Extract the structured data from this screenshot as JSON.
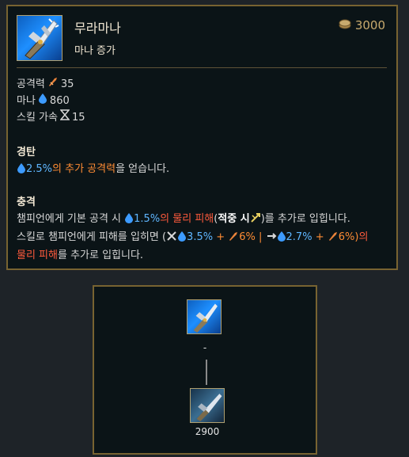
{
  "item": {
    "name": "무라마나",
    "subtitle": "마나 증가",
    "price": "3000",
    "icon": "muramana-item-icon"
  },
  "stats": [
    {
      "label": "공격력",
      "icon": "attack-damage-icon",
      "value": "35"
    },
    {
      "label": "마나",
      "icon": "mana-icon",
      "value": "860"
    },
    {
      "label": "스킬 가속",
      "icon": "ability-haste-icon",
      "value": "15"
    }
  ],
  "passive1": {
    "title": "경탄",
    "pct": "2.5%",
    "highlight": "의 추가 공격력",
    "rest": "을 얻습니다."
  },
  "passive2": {
    "title": "충격",
    "l1_a": "챔피언에게 기본 공격 시 ",
    "l1_pct": "1.5%",
    "l1_dmg": "의 물리 피해",
    "l1_paren_open": "(",
    "l1_onhit": "적중 시",
    "l1_paren_close": ")를 추가로 입힙니다.",
    "l2_a": "스킬로 챔피언에게 피해를 입히면 (",
    "l2_v1": "3.5%",
    "l2_plus1": " + ",
    "l2_v2": "6%",
    "l2_sep": " | ",
    "l2_v3": "2.7%",
    "l2_plus2": " + ",
    "l2_v4": "6%)",
    "l2_tail": "의",
    "l3_dmg": "물리 피해",
    "l3_rest": "를 추가로 입힙니다."
  },
  "tree": {
    "top_label": "-",
    "bottom_label": "2900"
  },
  "colors": {
    "border": "#786331",
    "gold": "#c8aa6e",
    "blue": "#5fb6ff",
    "orange": "#ff8c34",
    "red": "#ff5a3c"
  }
}
